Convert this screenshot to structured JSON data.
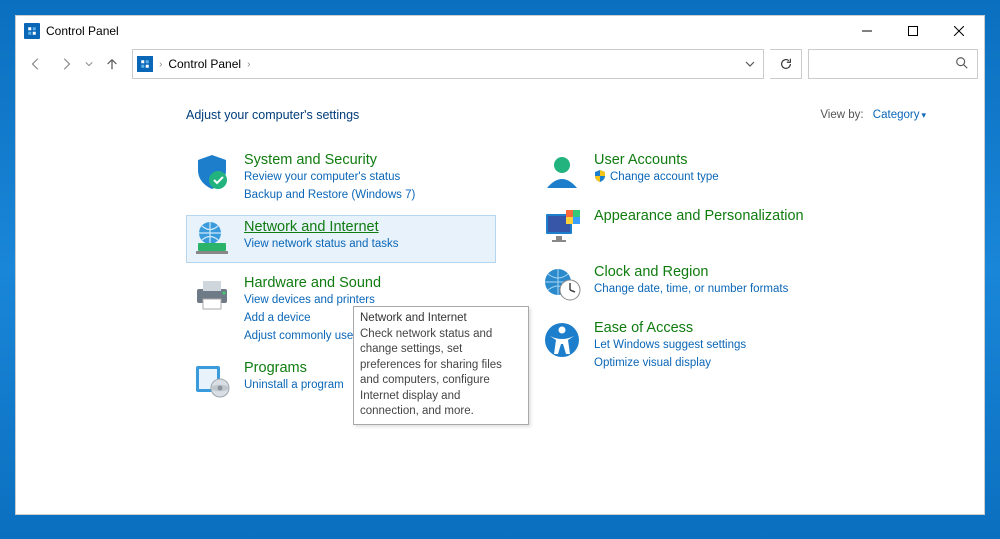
{
  "window": {
    "title": "Control Panel"
  },
  "address": {
    "root": "Control Panel"
  },
  "heading": "Adjust your computer's settings",
  "viewby": {
    "label": "View by:",
    "value": "Category"
  },
  "left": [
    {
      "title": "System and Security",
      "links": [
        "Review your computer's status",
        "Backup and Restore (Windows 7)"
      ]
    },
    {
      "title": "Network and Internet",
      "links": [
        "View network status and tasks"
      ]
    },
    {
      "title": "Hardware and Sound",
      "links": [
        "View devices and printers",
        "Add a device",
        "Adjust commonly used mobility settings"
      ]
    },
    {
      "title": "Programs",
      "links": [
        "Uninstall a program"
      ]
    }
  ],
  "right": [
    {
      "title": "User Accounts",
      "links": [
        "Change account type"
      ],
      "shield": [
        true
      ]
    },
    {
      "title": "Appearance and Personalization",
      "links": []
    },
    {
      "title": "Clock and Region",
      "links": [
        "Change date, time, or number formats"
      ]
    },
    {
      "title": "Ease of Access",
      "links": [
        "Let Windows suggest settings",
        "Optimize visual display"
      ]
    }
  ],
  "tooltip": {
    "title": "Network and Internet",
    "body": "Check network status and change settings, set preferences for sharing files and computers, configure Internet display and connection, and more."
  }
}
